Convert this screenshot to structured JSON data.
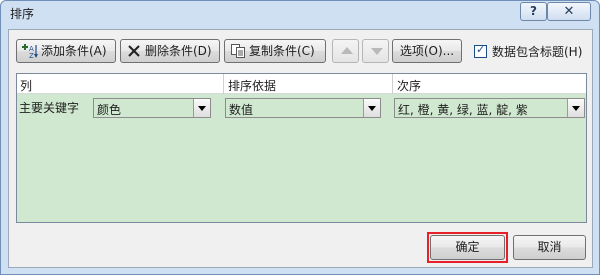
{
  "window": {
    "title": "排序",
    "help_label": "?",
    "close_label": "✕"
  },
  "toolbar": {
    "add_label": "添加条件(A)",
    "delete_label": "删除条件(D)",
    "copy_label": "复制条件(C)",
    "options_label": "选项(O)...",
    "header_checkbox_label": "数据包含标题(H)",
    "header_checked": true
  },
  "grid": {
    "headers": {
      "column": "列",
      "sort_on": "排序依据",
      "order": "次序"
    },
    "row": {
      "label": "主要关键字",
      "column_value": "颜色",
      "sort_on_value": "数值",
      "order_value": "红, 橙, 黄, 绿, 蓝, 靛, 紫"
    }
  },
  "footer": {
    "ok_label": "确定",
    "cancel_label": "取消"
  },
  "colors": {
    "grid_background": "#cfe8cf",
    "highlight_frame": "#e8202a",
    "title_bar": "#cfe0f2"
  },
  "icons": [
    "add-condition-icon",
    "delete-x-icon",
    "copy-icon",
    "move-up-icon",
    "move-down-icon",
    "chevron-down-icon"
  ]
}
